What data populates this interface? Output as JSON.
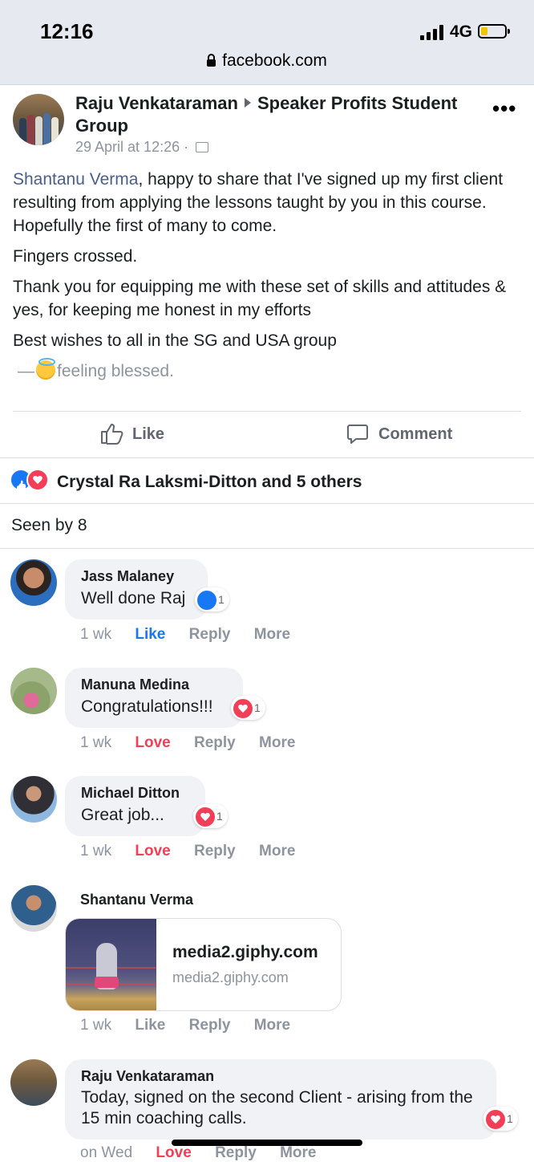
{
  "status_bar": {
    "time": "12:16",
    "network": "4G"
  },
  "url_bar": {
    "domain": "facebook.com"
  },
  "post": {
    "author": "Raju Venkataraman",
    "group": "Speaker Profits Student Group",
    "timestamp": "29 April at 12:26 ·",
    "mention": "Shantanu Verma",
    "paragraph1_rest": ", happy to share that I've signed up my first client resulting from applying the lessons taught by you in this course. Hopefully the first of many to come.",
    "paragraph2": "Fingers crossed.",
    "paragraph3": "Thank you for equipping me with these set of skills and attitudes & yes, for keeping me honest in my efforts",
    "paragraph4": "Best wishes to all in the SG and USA group",
    "feeling_prefix": "—",
    "feeling": "feeling blessed."
  },
  "actions": {
    "like_label": "Like",
    "comment_label": "Comment"
  },
  "reactions_summary": "Crystal Ra Laksmi-Ditton and 5 others",
  "seen_by": "Seen by 8",
  "comments": [
    {
      "name": "Jass Malaney",
      "text": "Well done Raj",
      "reaction_count": "1",
      "time": "1 wk",
      "like": "Like",
      "reply": "Reply",
      "more": "More"
    },
    {
      "name": "Manuna Medina",
      "text": "Congratulations!!!",
      "reaction_count": "1",
      "time": "1 wk",
      "like": "Love",
      "reply": "Reply",
      "more": "More"
    },
    {
      "name": "Michael Ditton",
      "text": "Great job...",
      "reaction_count": "1",
      "time": "1 wk",
      "like": "Love",
      "reply": "Reply",
      "more": "More"
    },
    {
      "name": "Shantanu Verma",
      "link_title": "media2.giphy.com",
      "link_sub": "media2.giphy.com",
      "time": "1 wk",
      "like": "Like",
      "reply": "Reply",
      "more": "More"
    },
    {
      "name": "Raju Venkataraman",
      "text": "Today, signed on the second Client - arising from the 15 min coaching calls.",
      "reaction_count": "1",
      "time": "on Wed",
      "like": "Love",
      "reply": "Reply",
      "more": "More"
    }
  ],
  "colors": {
    "accent": "#1877f2",
    "love": "#f33e58",
    "mention": "#4b5d8f",
    "muted": "#8d949e"
  }
}
